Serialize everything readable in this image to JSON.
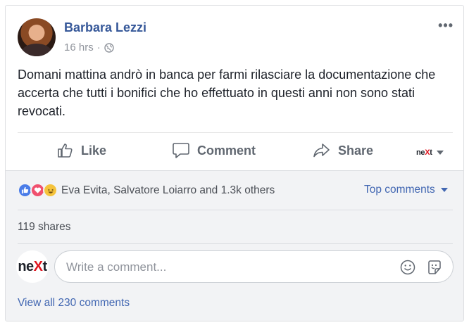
{
  "post": {
    "author": "Barbara Lezzi",
    "time": "16 hrs",
    "separator": "·",
    "privacy_icon": "globe-icon",
    "more_label": "•••",
    "text": "Domani mattina andrò in banca per farmi rilasciare la documentazione che accerta che tutti i bonifici che ho effettuato in questi anni non sono stati revocati."
  },
  "actions": {
    "like": "Like",
    "comment": "Comment",
    "share": "Share",
    "page_selector": "neXt"
  },
  "reactions": {
    "icons": [
      "like-icon",
      "love-icon",
      "haha-icon"
    ],
    "summary": "Eva Evita, Salvatore Loiarro and 1.3k others",
    "sort_label": "Top comments"
  },
  "shares": "119 shares",
  "composer": {
    "avatar_label": "neXt",
    "placeholder": "Write a comment..."
  },
  "view_all": "View all 230 comments",
  "colors": {
    "link": "#365899",
    "accent": "#4267b2",
    "muted": "#90949c",
    "next_red": "#e0141e"
  }
}
